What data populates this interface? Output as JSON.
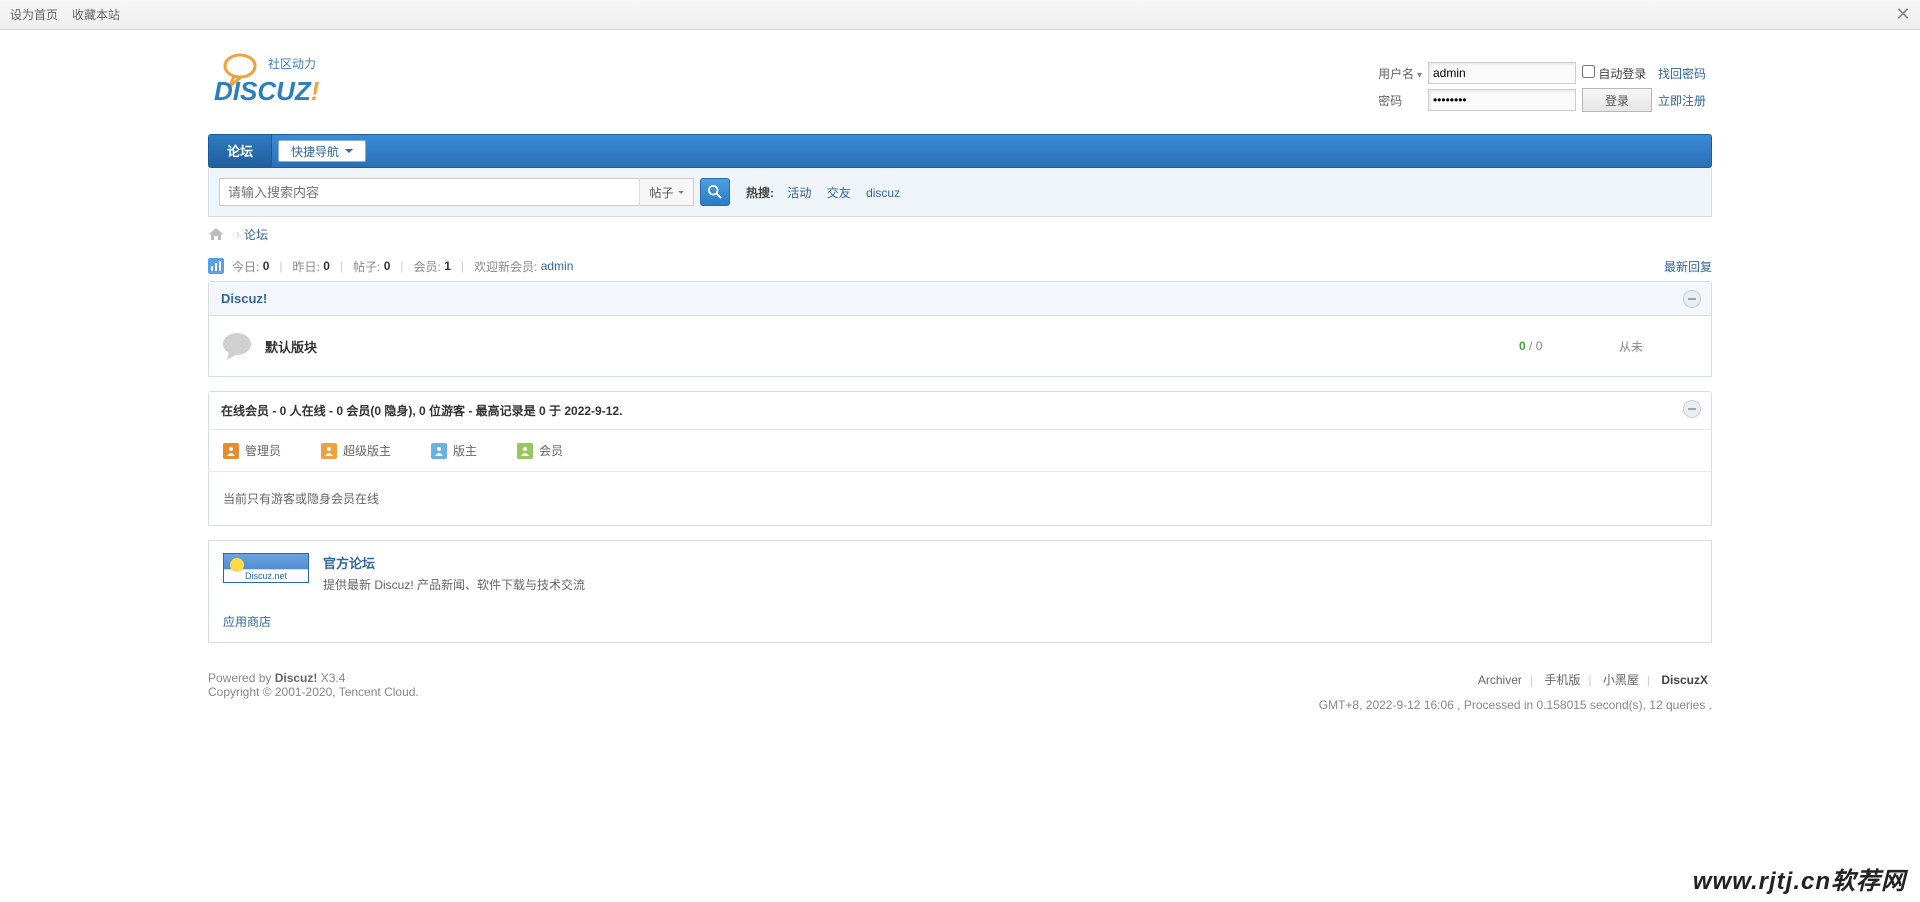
{
  "topbar": {
    "set_home": "设为首页",
    "favorite": "收藏本站"
  },
  "login": {
    "user_label": "用户名",
    "user_value": "admin",
    "pass_label": "密码",
    "pass_value": "••••••••",
    "auto": "自动登录",
    "btn": "登录",
    "forgot": "找回密码",
    "register": "立即注册"
  },
  "nav": {
    "forum": "论坛",
    "quicknav": "快捷导航"
  },
  "search": {
    "placeholder": "请输入搜索内容",
    "type": "帖子",
    "hot_label": "热搜:",
    "hot": [
      "活动",
      "交友",
      "discuz"
    ]
  },
  "crumb": {
    "forum": "论坛"
  },
  "stats": {
    "today_l": "今日:",
    "today_v": "0",
    "yesterday_l": "昨日:",
    "yesterday_v": "0",
    "posts_l": "帖子:",
    "posts_v": "0",
    "members_l": "会员:",
    "members_v": "1",
    "welcome_l": "欢迎新会员:",
    "welcome_v": "admin",
    "latest": "最新回复"
  },
  "category": {
    "name": "Discuz!",
    "forums": [
      {
        "title": "默认版块",
        "threads": "0",
        "posts": "0",
        "last": "从未"
      }
    ]
  },
  "online": {
    "head": "在线会员 - 0 人在线 - 0 会员(0 隐身), 0 位游客 - 最高记录是 0 于 2022-9-12.",
    "legends": [
      {
        "color": "#e98b2f",
        "label": "管理员"
      },
      {
        "color": "#f0a03c",
        "label": "超级版主"
      },
      {
        "color": "#6ab0e2",
        "label": "版主"
      },
      {
        "color": "#9ac75d",
        "label": "会员"
      }
    ],
    "msg": "当前只有游客或隐身会员在线"
  },
  "links": {
    "official_title": "官方论坛",
    "official_desc": "提供最新 Discuz! 产品新闻、软件下载与技术交流",
    "thumb_label": "Discuz.net",
    "appstore": "应用商店"
  },
  "footer": {
    "powered": "Powered by ",
    "product": "Discuz!",
    "version": " X3.4",
    "copyright": "Copyright © 2001-2020, Tencent Cloud.",
    "links": [
      "Archiver",
      "手机版",
      "小黑屋",
      "DiscuzX"
    ],
    "timing": "GMT+8, 2022-9-12 16:06 , Processed in 0.158015 second(s), 12 queries ."
  },
  "watermark": "www.rjtj.cn软荐网"
}
